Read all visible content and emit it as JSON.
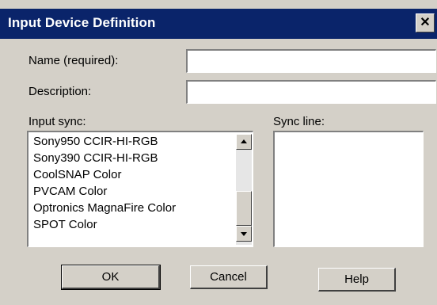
{
  "window": {
    "title": "Input Device Definition",
    "close_glyph": "✕"
  },
  "form": {
    "name_label": "Name (required):",
    "name_value": "",
    "description_label": "Description:",
    "description_value": "",
    "input_sync_label": "Input sync:",
    "sync_line_label": "Sync line:"
  },
  "input_sync_list": {
    "items": [
      "Sony950 CCIR-HI-RGB",
      "Sony390 CCIR-HI-RGB",
      "CoolSNAP Color",
      "PVCAM Color",
      "Optronics MagnaFire Color",
      "SPOT Color"
    ]
  },
  "sync_line_list": {
    "items": []
  },
  "buttons": {
    "ok": "OK",
    "cancel": "Cancel",
    "help": "Help"
  },
  "colors": {
    "titlebar": "#0a246a",
    "face": "#d4d0c8",
    "field": "#ffffff"
  }
}
